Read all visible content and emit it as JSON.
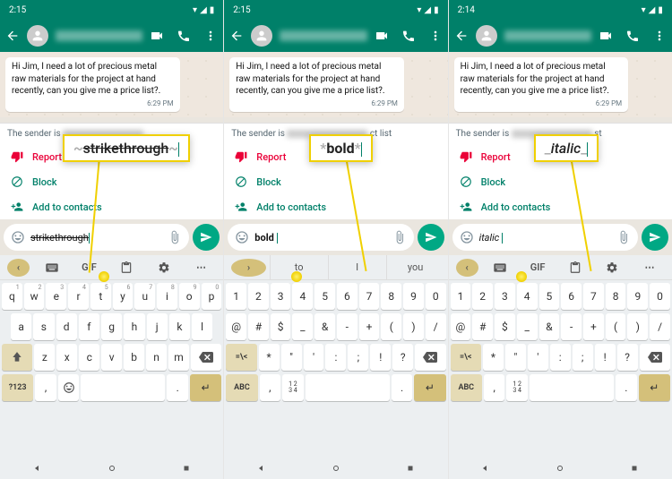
{
  "panes": [
    {
      "time": "2:15",
      "message": "Hi Jim, I need a lot of precious metal raw materials for the project at hand recently, can you give me a price list?.",
      "msg_time": "6:29 PM",
      "sender_prefix": "The sender is",
      "actions": {
        "report": "Report",
        "block": "Block",
        "add": "Add to contacts"
      },
      "input_display": "strikethrough",
      "input_style": "strike",
      "callout": {
        "pre": "~",
        "text": "strikethrough",
        "post": "~",
        "style": "strike"
      },
      "kb_type": "qwerty",
      "kb_toolbar": [
        "‹",
        "⌨",
        "GIF",
        "📋",
        "⚙",
        "…"
      ],
      "row1": [
        "q",
        "w",
        "e",
        "r",
        "t",
        "y",
        "u",
        "i",
        "o",
        "p"
      ],
      "row1_sup": [
        "1",
        "2",
        "3",
        "4",
        "5",
        "6",
        "7",
        "8",
        "9",
        "0"
      ],
      "row2": [
        "a",
        "s",
        "d",
        "f",
        "g",
        "h",
        "j",
        "k",
        "l"
      ],
      "row3": [
        "z",
        "x",
        "c",
        "v",
        "b",
        "n",
        "m"
      ],
      "row4": {
        "sym": "?123",
        "comma": ",",
        "emoji": "☺",
        "period": ".",
        "enter": "↵"
      }
    },
    {
      "time": "2:15",
      "message": "Hi Jim, I need a lot of precious metal raw materials for the project at hand recently, can you give me a price list?.",
      "msg_time": "6:29 PM",
      "sender_prefix": "The sender is",
      "sender_suffix": "ct list",
      "actions": {
        "report": "Report",
        "block": "Block",
        "add": "Add to contacts"
      },
      "input_display": "bold ",
      "input_style": "bold",
      "callout": {
        "pre": "*",
        "text": "bold",
        "post": "*",
        "style": "bold"
      },
      "kb_type": "numeric",
      "kb_suggestions": [
        "to",
        "I",
        "you"
      ],
      "row1": [
        "1",
        "2",
        "3",
        "4",
        "5",
        "6",
        "7",
        "8",
        "9",
        "0"
      ],
      "row2": [
        "@",
        "#",
        "$",
        "_",
        "&",
        "-",
        "+",
        "(",
        ")",
        "/"
      ],
      "row3": [
        "*",
        "\"",
        "'",
        ":",
        ";",
        "!",
        "?"
      ],
      "row4": {
        "sym": "ABC",
        "comma": ",",
        "nums": "1 2\n3 4",
        "period": ".",
        "enter": "↵"
      }
    },
    {
      "time": "2:14",
      "message": "Hi Jim, I need a lot of precious metal raw materials for the project at hand recently, can you give me a price list?.",
      "msg_time": "6:29 PM",
      "sender_prefix": "The sender is",
      "sender_suffix": "st",
      "actions": {
        "report": "Report",
        "block": "Block",
        "add": "Add to contacts"
      },
      "input_display": "italic ",
      "input_style": "italic",
      "callout": {
        "pre": "_",
        "text": "italic",
        "post": "_",
        "style": "italic"
      },
      "kb_type": "numeric",
      "kb_toolbar": [
        "‹",
        "⌨",
        "GIF",
        "📋",
        "⚙",
        "…"
      ],
      "row1": [
        "1",
        "2",
        "3",
        "4",
        "5",
        "6",
        "7",
        "8",
        "9",
        "0"
      ],
      "row2": [
        "@",
        "#",
        "$",
        "_",
        "&",
        "-",
        "+",
        "(",
        ")",
        "/"
      ],
      "row3": [
        "*",
        "\"",
        "'",
        ":",
        ";",
        "!",
        "?"
      ],
      "row4": {
        "sym": "ABC",
        "comma": ",",
        "nums": "1 2\n3 4",
        "period": ".",
        "enter": "↵"
      }
    }
  ]
}
